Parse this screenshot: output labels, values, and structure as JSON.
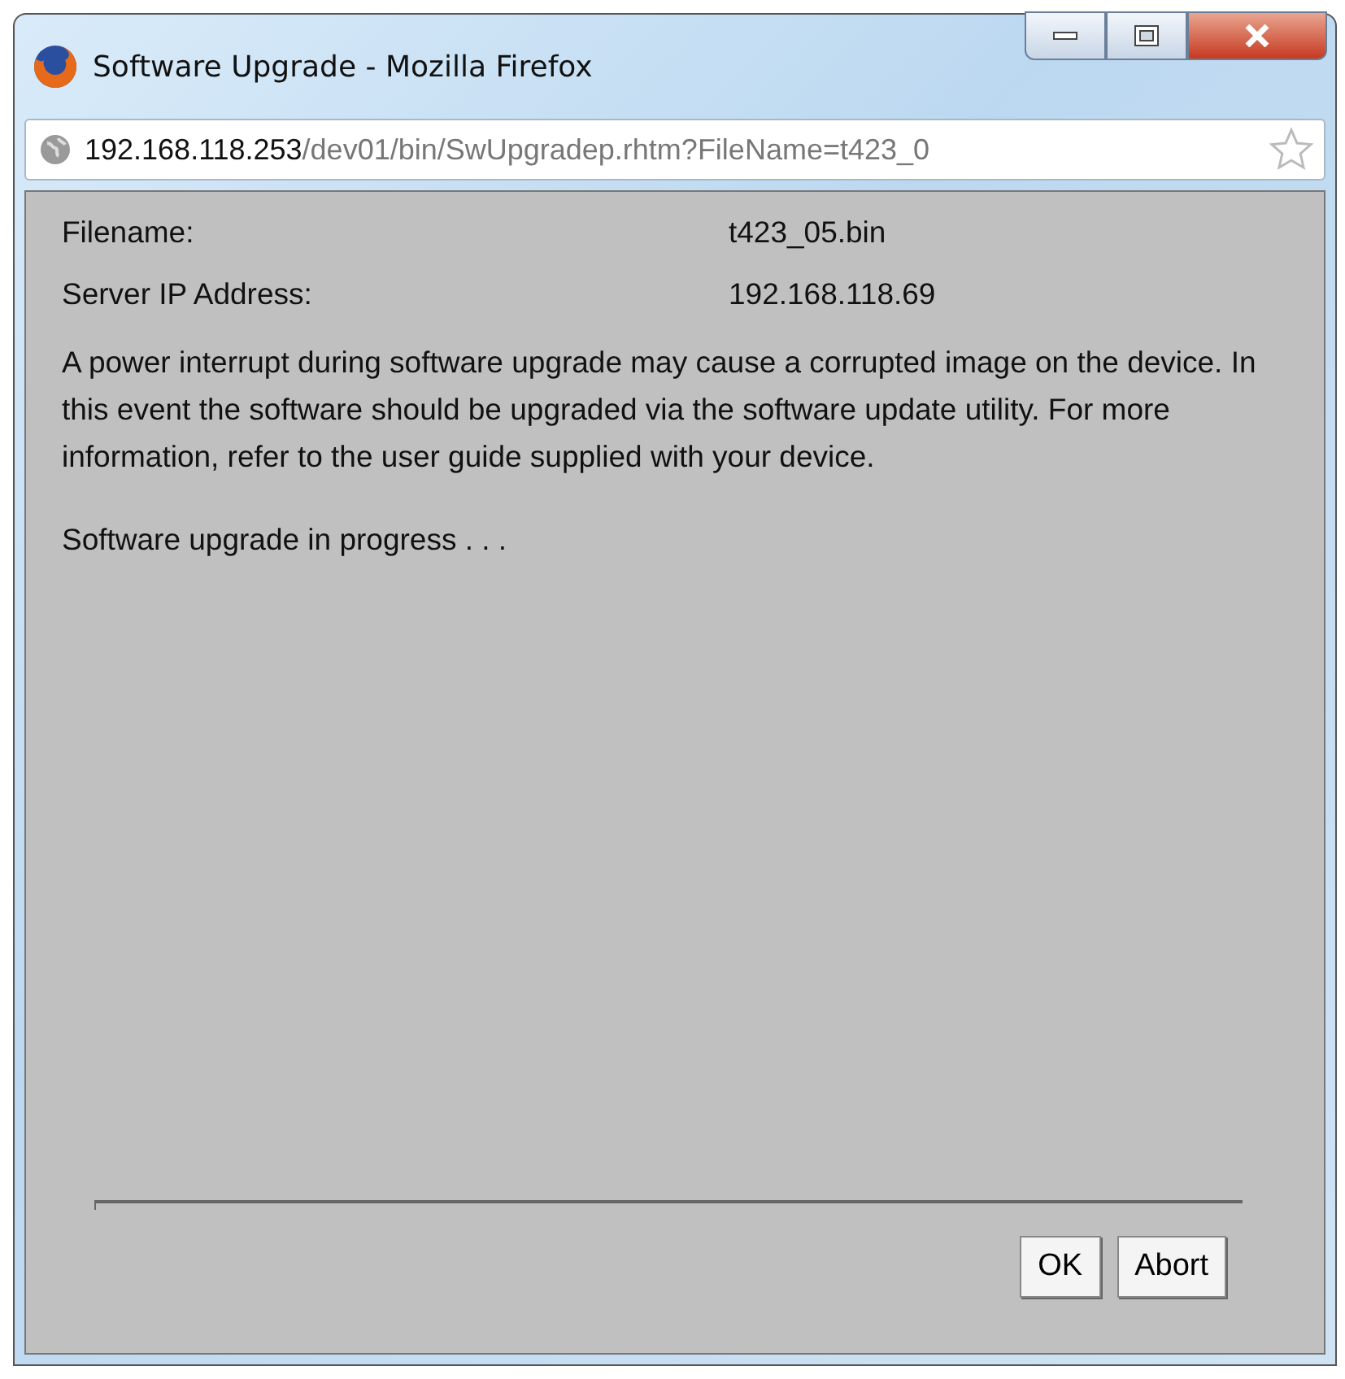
{
  "window": {
    "title": "Software Upgrade - Mozilla Firefox"
  },
  "address_bar": {
    "host": "192.168.118.253",
    "path": "/dev01/bin/SwUpgradep.rhtm?FileName=t423_0"
  },
  "fields": [
    {
      "label": "Filename:",
      "value": "t423_05.bin"
    },
    {
      "label": "Server IP Address:",
      "value": "192.168.118.69"
    }
  ],
  "warning": "A power interrupt during software upgrade may cause a corrupted image on the device. In this event the software should be upgraded via the software update utility. For more information, refer to the user guide supplied with your device.",
  "status": "Software upgrade in progress . . .",
  "buttons": [
    "OK",
    "Abort"
  ]
}
